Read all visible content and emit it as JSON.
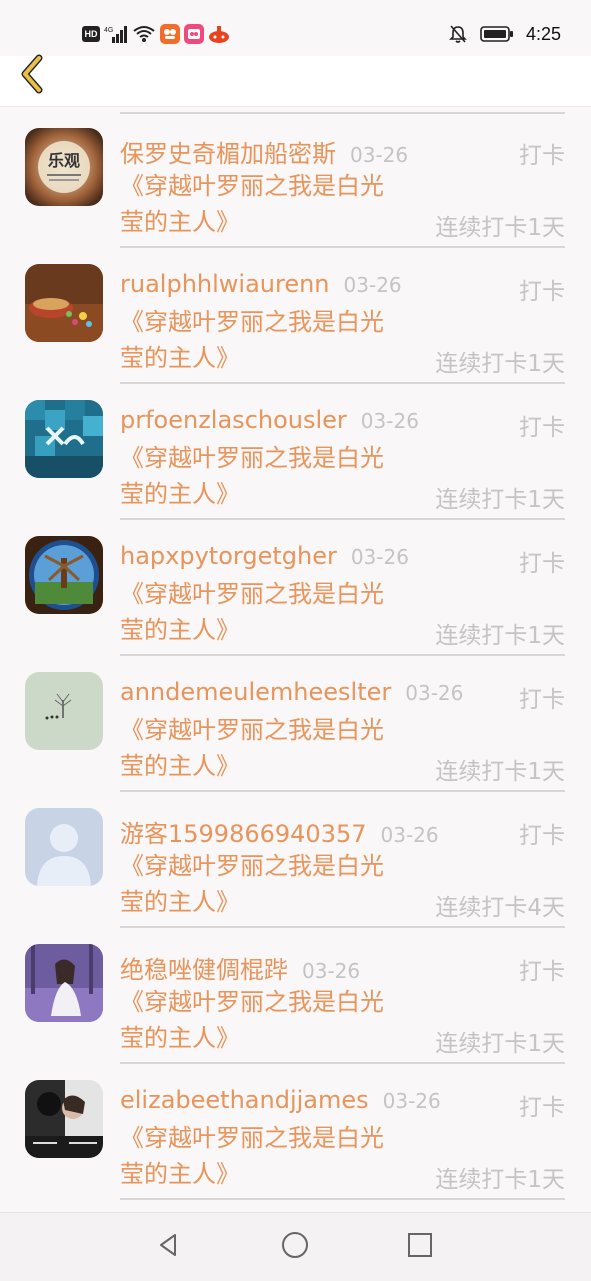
{
  "status_bar": {
    "network_badge": "HD",
    "signal_label": "4G",
    "time": "4:25",
    "icons": [
      "hd-icon",
      "signal-icon",
      "wifi-icon",
      "app-icon",
      "app-icon",
      "app-icon",
      "mute-icon",
      "battery-icon"
    ]
  },
  "header": {
    "back_icon": "chevron-left-icon",
    "accent_color": "#e9c14a"
  },
  "colors": {
    "name": "#e9945a",
    "muted": "#c4c4c4",
    "divider": "#d9d6d6",
    "background": "#f9f7f7"
  },
  "list": {
    "items": [
      {
        "name": "保罗史奇楣加船密斯",
        "date": "03-26",
        "action": "打卡",
        "book": "《穿越叶罗丽之我是白光莹的主人》",
        "streak": "连续打卡1天",
        "avatar_text": "乐观"
      },
      {
        "name": "rualphhlwiaurenn",
        "date": "03-26",
        "action": "打卡",
        "book": "《穿越叶罗丽之我是白光莹的主人》",
        "streak": "连续打卡1天"
      },
      {
        "name": "prfoenzlaschousler",
        "date": "03-26",
        "action": "打卡",
        "book": "《穿越叶罗丽之我是白光莹的主人》",
        "streak": "连续打卡1天"
      },
      {
        "name": "hapxpytorgetgher",
        "date": "03-26",
        "action": "打卡",
        "book": "《穿越叶罗丽之我是白光莹的主人》",
        "streak": "连续打卡1天"
      },
      {
        "name": "anndemeulemheeslter",
        "date": "03-26",
        "action": "打卡",
        "book": "《穿越叶罗丽之我是白光莹的主人》",
        "streak": "连续打卡1天"
      },
      {
        "name": "游客1599866940357",
        "date": "03-26",
        "action": "打卡",
        "book": "《穿越叶罗丽之我是白光莹的主人》",
        "streak": "连续打卡4天"
      },
      {
        "name": "绝稳唑健倜棍跸",
        "date": "03-26",
        "action": "打卡",
        "book": "《穿越叶罗丽之我是白光莹的主人》",
        "streak": "连续打卡1天"
      },
      {
        "name": "elizabeethandjjames",
        "date": "03-26",
        "action": "打卡",
        "book": "《穿越叶罗丽之我是白光莹的主人》",
        "streak": "连续打卡1天"
      }
    ]
  },
  "nav": {
    "back_icon": "triangle-back-icon",
    "home_icon": "circle-home-icon",
    "recents_icon": "square-recents-icon"
  }
}
